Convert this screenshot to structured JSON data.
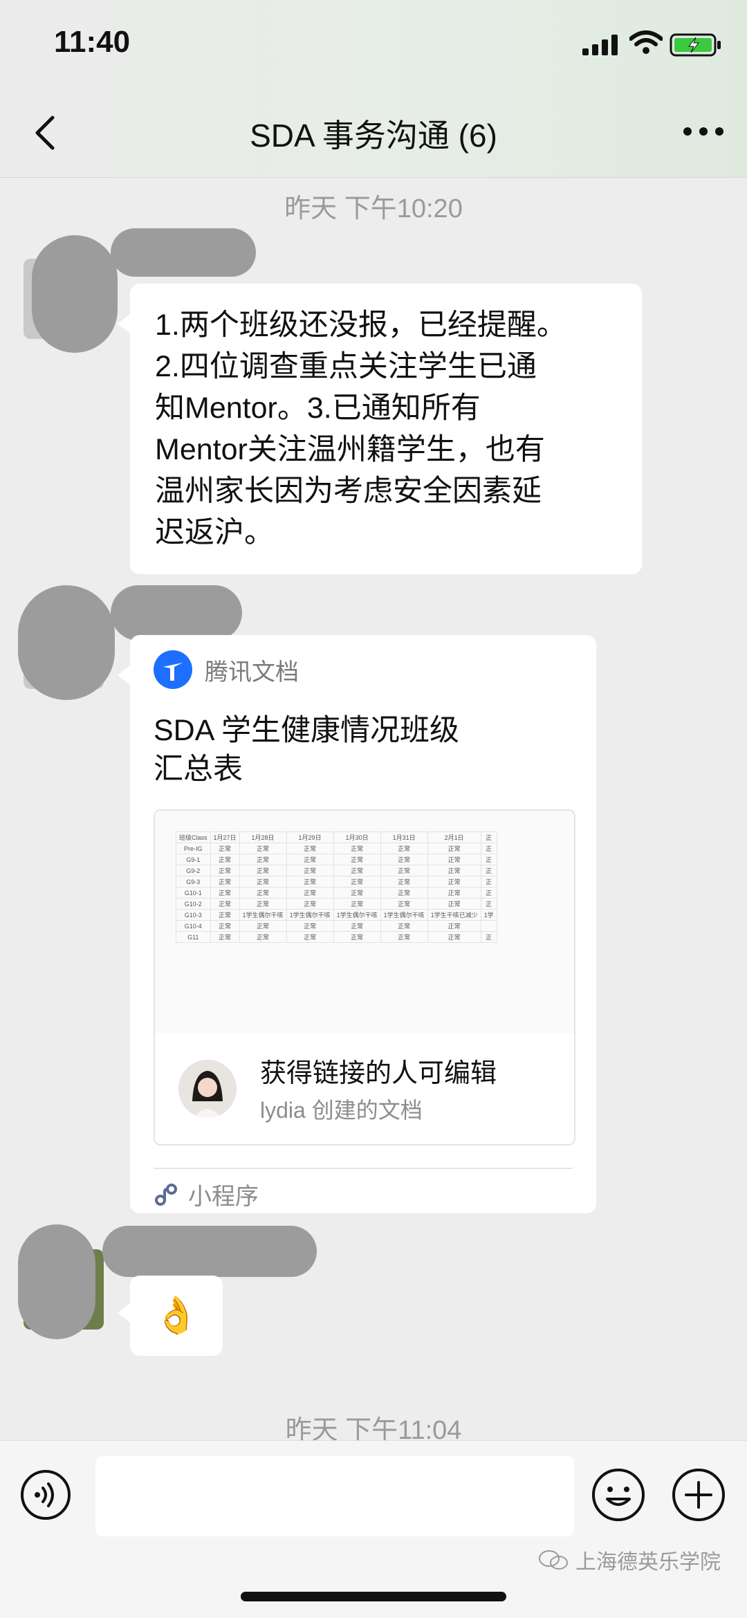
{
  "status": {
    "time": "11:40"
  },
  "nav": {
    "title": "SDA 事务沟通 (6)"
  },
  "timestamps": {
    "first": "昨天 下午10:20",
    "second": "昨天 下午11:04"
  },
  "messages": {
    "m1": {
      "text": "1.两个班级还没报，已经提醒。\n2.四位调查重点关注学生已通\n知Mentor。3.已通知所有\nMentor关注温州籍学生，也有\n温州家长因为考虑安全因素延\n迟返沪。"
    },
    "m2": {
      "source": "腾讯文档",
      "title": "SDA 学生健康情况班级\n汇总表",
      "permission": "获得链接的人可编辑",
      "creator": "lydia 创建的文档",
      "footer": "小程序",
      "sheet": {
        "header": [
          "班级Class",
          "1月27日",
          "1月28日",
          "1月29日",
          "1月30日",
          "1月31日",
          "2月1日",
          "正"
        ],
        "rows": [
          [
            "Pre-IG",
            "正常",
            "正常",
            "正常",
            "正常",
            "正常",
            "正常",
            "正"
          ],
          [
            "G9-1",
            "正常",
            "正常",
            "正常",
            "正常",
            "正常",
            "正常",
            "正"
          ],
          [
            "G9-2",
            "正常",
            "正常",
            "正常",
            "正常",
            "正常",
            "正常",
            "正"
          ],
          [
            "G9-3",
            "正常",
            "正常",
            "正常",
            "正常",
            "正常",
            "正常",
            "正"
          ],
          [
            "G10-1",
            "正常",
            "正常",
            "正常",
            "正常",
            "正常",
            "正常",
            "正"
          ],
          [
            "G10-2",
            "正常",
            "正常",
            "正常",
            "正常",
            "正常",
            "正常",
            "正"
          ],
          [
            "G10-3",
            "正常",
            "1学生偶尔干咳",
            "1学生偶尔干咳",
            "1学生偶尔干咳",
            "1学生偶尔干咳",
            "1学生干咳已减少",
            "1学"
          ],
          [
            "G10-4",
            "正常",
            "正常",
            "正常",
            "正常",
            "正常",
            "正常",
            ""
          ],
          [
            "G11",
            "正常",
            "正常",
            "正常",
            "正常",
            "正常",
            "正常",
            "正"
          ]
        ]
      }
    },
    "m3": {
      "emoji": "👌"
    }
  },
  "watermark": "上海德英乐学院"
}
